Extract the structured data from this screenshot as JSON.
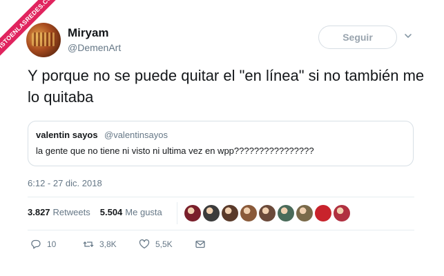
{
  "watermark": {
    "text": "VISTOENLASREDES.COM"
  },
  "author": {
    "display_name": "Miryam",
    "handle": "@DemenArt"
  },
  "follow_button": {
    "label": "Seguir"
  },
  "tweet": {
    "text": "Y porque no se puede quitar el \"en línea\" si no también me lo quitaba",
    "timestamp": "6:12 - 27 dic. 2018"
  },
  "quoted_tweet": {
    "name": "valentin sayos",
    "handle": "@valentinsayos",
    "text": "la gente que no tiene ni visto ni ultima vez en wpp????????????????"
  },
  "stats": {
    "retweets_count": "3.827",
    "retweets_label": "Retweets",
    "likes_count": "5.504",
    "likes_label": "Me gusta"
  },
  "likers": {
    "avatar_colors": [
      "#7a1f2b",
      "#3b3b3b",
      "#5a3a2a",
      "#8a5a3a",
      "#6b4a3a",
      "#4a6b5a",
      "#7a6a4a",
      "#c8232c",
      "#b03040"
    ]
  },
  "actions": {
    "reply_count": "10",
    "retweet_count": "3,8K",
    "like_count": "5,5K"
  },
  "icons": {
    "reply": "reply-icon",
    "retweet": "retweet-icon",
    "like": "heart-icon",
    "dm": "mail-icon",
    "caret": "chevron-down-icon"
  },
  "colors": {
    "text": "#14171a",
    "secondary": "#657786",
    "border": "#e6ecf0",
    "watermark": "#e0245e"
  }
}
